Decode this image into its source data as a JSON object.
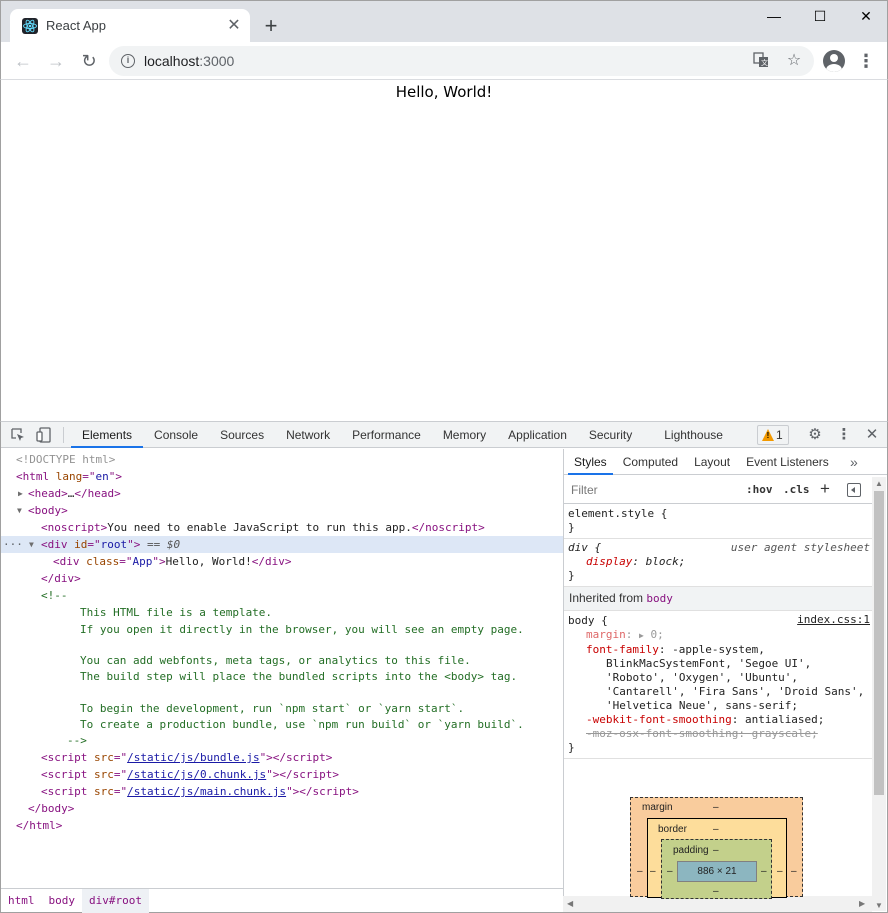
{
  "browser": {
    "tab_title": "React App",
    "url_host": "localhost",
    "url_port": ":3000"
  },
  "page": {
    "hello_text": "Hello, World!"
  },
  "devtools": {
    "tabs": [
      "Elements",
      "Console",
      "Sources",
      "Network",
      "Performance",
      "Memory",
      "Application",
      "Security",
      "Lighthouse"
    ],
    "active_tab": "Elements",
    "warning_count": "1",
    "elements": {
      "doctype": "<!DOCTYPE html>",
      "html_lang": "en",
      "noscript_text": "You need to enable JavaScript to run this app.",
      "root_id": "root",
      "selected_marker": "== $0",
      "app_class": "App",
      "app_text": "Hello, World!",
      "comment_open": "<!--",
      "comment_lines": [
        "This HTML file is a template.",
        "If you open it directly in the browser, you will see an empty page.",
        "",
        "You can add webfonts, meta tags, or analytics to this file.",
        "The build step will place the bundled scripts into the <body> tag.",
        "",
        "To begin the development, run `npm start` or `yarn start`.",
        "To create a production bundle, use `npm run build` or `yarn build`."
      ],
      "comment_close": "-->",
      "scripts": [
        "/static/js/bundle.js",
        "/static/js/0.chunk.js",
        "/static/js/main.chunk.js"
      ]
    },
    "breadcrumbs": [
      "html",
      "body",
      "div#root"
    ],
    "sidebar": {
      "tabs": [
        "Styles",
        "Computed",
        "Layout",
        "Event Listeners"
      ],
      "active_tab": "Styles",
      "filter_placeholder": "Filter",
      "hov_label": ":hov",
      "cls_label": ".cls",
      "element_style": "element.style {",
      "ua_selector": "div {",
      "ua_label": "user agent stylesheet",
      "ua_prop": "display",
      "ua_val": "block;",
      "inherited_label": "Inherited from",
      "inherited_tag": "body",
      "body_selector": "body {",
      "body_source": "index.css:1",
      "body_rules": {
        "margin_prop": "margin",
        "margin_val": "0;",
        "font_prop": "font-family",
        "font_val_lines": [
          "-apple-system,",
          "BlinkMacSystemFont, 'Segoe UI',",
          "'Roboto', 'Oxygen', 'Ubuntu',",
          "'Cantarell', 'Fira Sans', 'Droid Sans',",
          "'Helvetica Neue', sans-serif;"
        ],
        "smoothing_prop": "-webkit-font-smoothing",
        "smoothing_val": "antialiased;",
        "osx_prop": "-moz-osx-font-smoothing",
        "osx_val": "grayscale;"
      },
      "boxmodel": {
        "margin_label": "margin",
        "border_label": "border",
        "padding_label": "padding",
        "dash": "–",
        "content_size": "886 × 21"
      }
    }
  },
  "colors": {
    "accent": "#1a73e8",
    "tag": "#881280",
    "attr_name": "#994500",
    "attr_value": "#1a1aa6",
    "comment": "#236e25"
  }
}
